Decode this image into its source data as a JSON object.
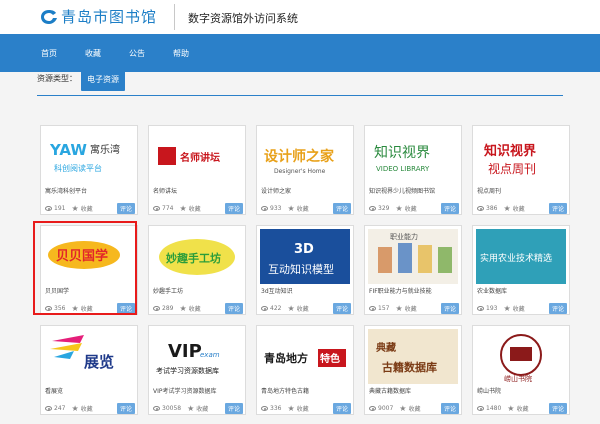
{
  "header": {
    "logo_text": "青岛市图书馆",
    "system_title": "数字资源馆外访问系统"
  },
  "nav": [
    "首页",
    "收藏",
    "公告",
    "帮助"
  ],
  "filter": {
    "label": "资源类型：",
    "button": "电子资源"
  },
  "review_label": "评论",
  "resources": [
    {
      "name": "寓乐湾科创平台",
      "views": "191",
      "fav": "收藏"
    },
    {
      "name": "名师讲坛",
      "views": "774",
      "fav": "收藏"
    },
    {
      "name": "设计师之家",
      "views": "933",
      "fav": "收藏"
    },
    {
      "name": "知识视界少儿视频图书馆",
      "views": "329",
      "fav": "收藏"
    },
    {
      "name": "视点周刊",
      "views": "386",
      "fav": "收藏"
    },
    {
      "name": "贝贝国学",
      "views": "356",
      "fav": "收藏"
    },
    {
      "name": "妙趣手工坊",
      "views": "289",
      "fav": "收藏"
    },
    {
      "name": "3d互动知识",
      "views": "422",
      "fav": "收藏"
    },
    {
      "name": "FIF职业能力与就业技能",
      "views": "157",
      "fav": "收藏"
    },
    {
      "name": "农业数据库",
      "views": "193",
      "fav": "收藏"
    },
    {
      "name": "看展览",
      "views": "247",
      "fav": "收藏"
    },
    {
      "name": "VIP考试学习资源数据库",
      "views": "30058",
      "fav": "收藏"
    },
    {
      "name": "青岛地方特色古籍",
      "views": "336",
      "fav": "收藏"
    },
    {
      "name": "典藏古籍数据库",
      "views": "9007",
      "fav": "收藏"
    },
    {
      "name": "崂山书院",
      "views": "1480",
      "fav": "收藏"
    }
  ],
  "thumb_text": {
    "yaw_brand": "YAW",
    "yaw_cn": "寓乐湾",
    "yaw_sub": "科创阅读平台",
    "mingshi": "名师讲坛",
    "sheji": "设计师之家",
    "sheji_en": "Designer's Home",
    "zhishi_cn": "知识视界",
    "zhishi_en": "VIDEO LIBRARY",
    "shidian_top": "知识视界",
    "shidian_bottom": "视点周刊",
    "beibei": "贝贝国学",
    "miaoqu": "妙趣手工坊",
    "hudong": "互动知识模型",
    "hudong_3d": "3D",
    "fif_tag": "职业能力",
    "nongye": "实用农业技术精选",
    "zhanlan": "展览",
    "vip_big": "VIP",
    "vip_exam": "exam",
    "vip_sub": "考试学习资源数据库",
    "qingdao": "青岛地方",
    "qingdao_tag": "特色",
    "dianzang_top": "典藏",
    "dianzang_bottom": "古籍数据库",
    "laoshan": "崂山书院"
  }
}
